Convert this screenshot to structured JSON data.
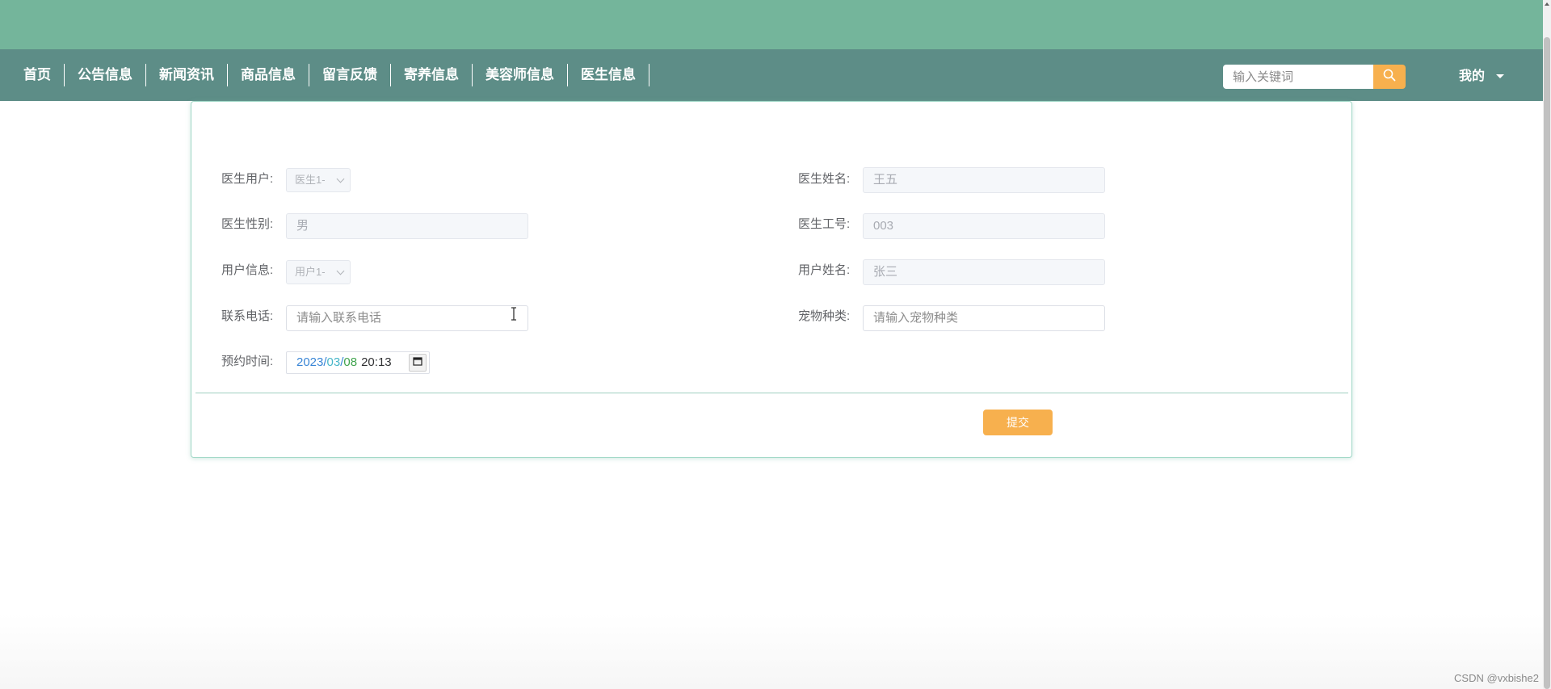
{
  "nav": {
    "items": [
      {
        "label": "首页"
      },
      {
        "label": "公告信息"
      },
      {
        "label": "新闻资讯"
      },
      {
        "label": "商品信息"
      },
      {
        "label": "留言反馈"
      },
      {
        "label": "寄养信息"
      },
      {
        "label": "美容师信息"
      },
      {
        "label": "医生信息"
      }
    ],
    "search_placeholder": "输入关键词",
    "search_icon": "search-icon",
    "user_menu_label": "我的"
  },
  "form": {
    "doctor_user": {
      "label": "医生用户:",
      "value": "医生1-"
    },
    "doctor_name": {
      "label": "医生姓名:",
      "value": "王五"
    },
    "doctor_gender": {
      "label": "医生性别:",
      "value": "男"
    },
    "doctor_id": {
      "label": "医生工号:",
      "value": "003"
    },
    "user_info": {
      "label": "用户信息:",
      "value": "用户1-"
    },
    "user_name": {
      "label": "用户姓名:",
      "value": "张三"
    },
    "phone": {
      "label": "联系电话:",
      "placeholder": "请输入联系电话"
    },
    "pet_type": {
      "label": "宠物种类:",
      "placeholder": "请输入宠物种类"
    },
    "appointment_time": {
      "label": "预约时间:",
      "year": "2023",
      "month": "03",
      "day": "08",
      "separator": "/",
      "time": "20:13"
    },
    "submit_label": "提交"
  },
  "watermark": "CSDN @vxbishe2",
  "colors": {
    "top_band": "#74b59b",
    "navbar": "#5d8d87",
    "accent": "#f7b04e",
    "card_border": "#9fd7c6"
  }
}
